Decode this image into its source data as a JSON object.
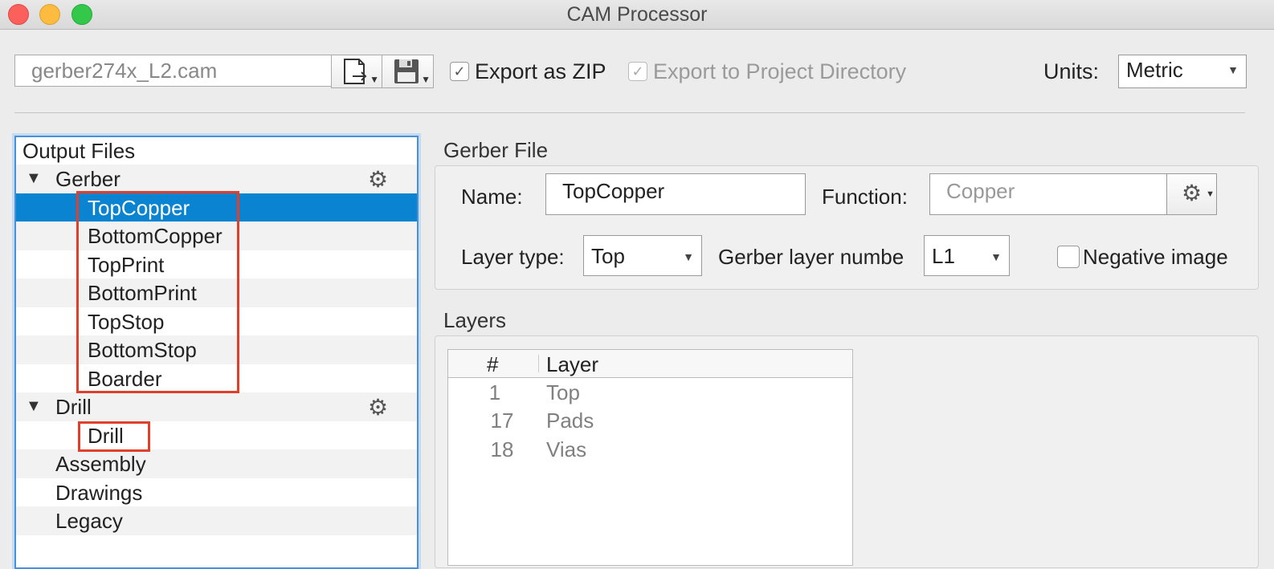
{
  "window": {
    "title": "CAM Processor"
  },
  "toolbar": {
    "file_name": "gerber274x_L2.cam",
    "export_zip_label": "Export as ZIP",
    "export_zip_checked": true,
    "export_project_label": "Export to Project Directory",
    "export_project_checked": true,
    "units_label": "Units:",
    "units_value": "Metric"
  },
  "output_files": {
    "header": "Output Files",
    "groups": [
      {
        "label": "Gerber",
        "items": [
          "TopCopper",
          "BottomCopper",
          "TopPrint",
          "BottomPrint",
          "TopStop",
          "BottomStop",
          "Boarder"
        ]
      },
      {
        "label": "Drill",
        "items": [
          "Drill"
        ]
      }
    ],
    "others": [
      "Assembly",
      "Drawings",
      "Legacy"
    ],
    "selected": "TopCopper"
  },
  "gerber_file": {
    "title": "Gerber File",
    "name_label": "Name:",
    "name_value": "TopCopper",
    "function_label": "Function:",
    "function_placeholder": "Copper",
    "layer_type_label": "Layer type:",
    "layer_type_value": "Top",
    "gerber_layer_number_label": "Gerber layer numbe",
    "gerber_layer_number_value": "L1",
    "negative_image_label": "Negative image",
    "negative_image_checked": false
  },
  "layers": {
    "title": "Layers",
    "columns": [
      "#",
      "Layer"
    ],
    "rows": [
      {
        "num": "1",
        "name": "Top"
      },
      {
        "num": "17",
        "name": "Pads"
      },
      {
        "num": "18",
        "name": "Vias"
      }
    ]
  },
  "icons": {
    "gear": "gear-icon",
    "export": "export-file-icon",
    "save": "floppy-disk-icon",
    "checkmark": "✓",
    "triangle_down": "▼",
    "dropdown_arrow": "▼"
  }
}
